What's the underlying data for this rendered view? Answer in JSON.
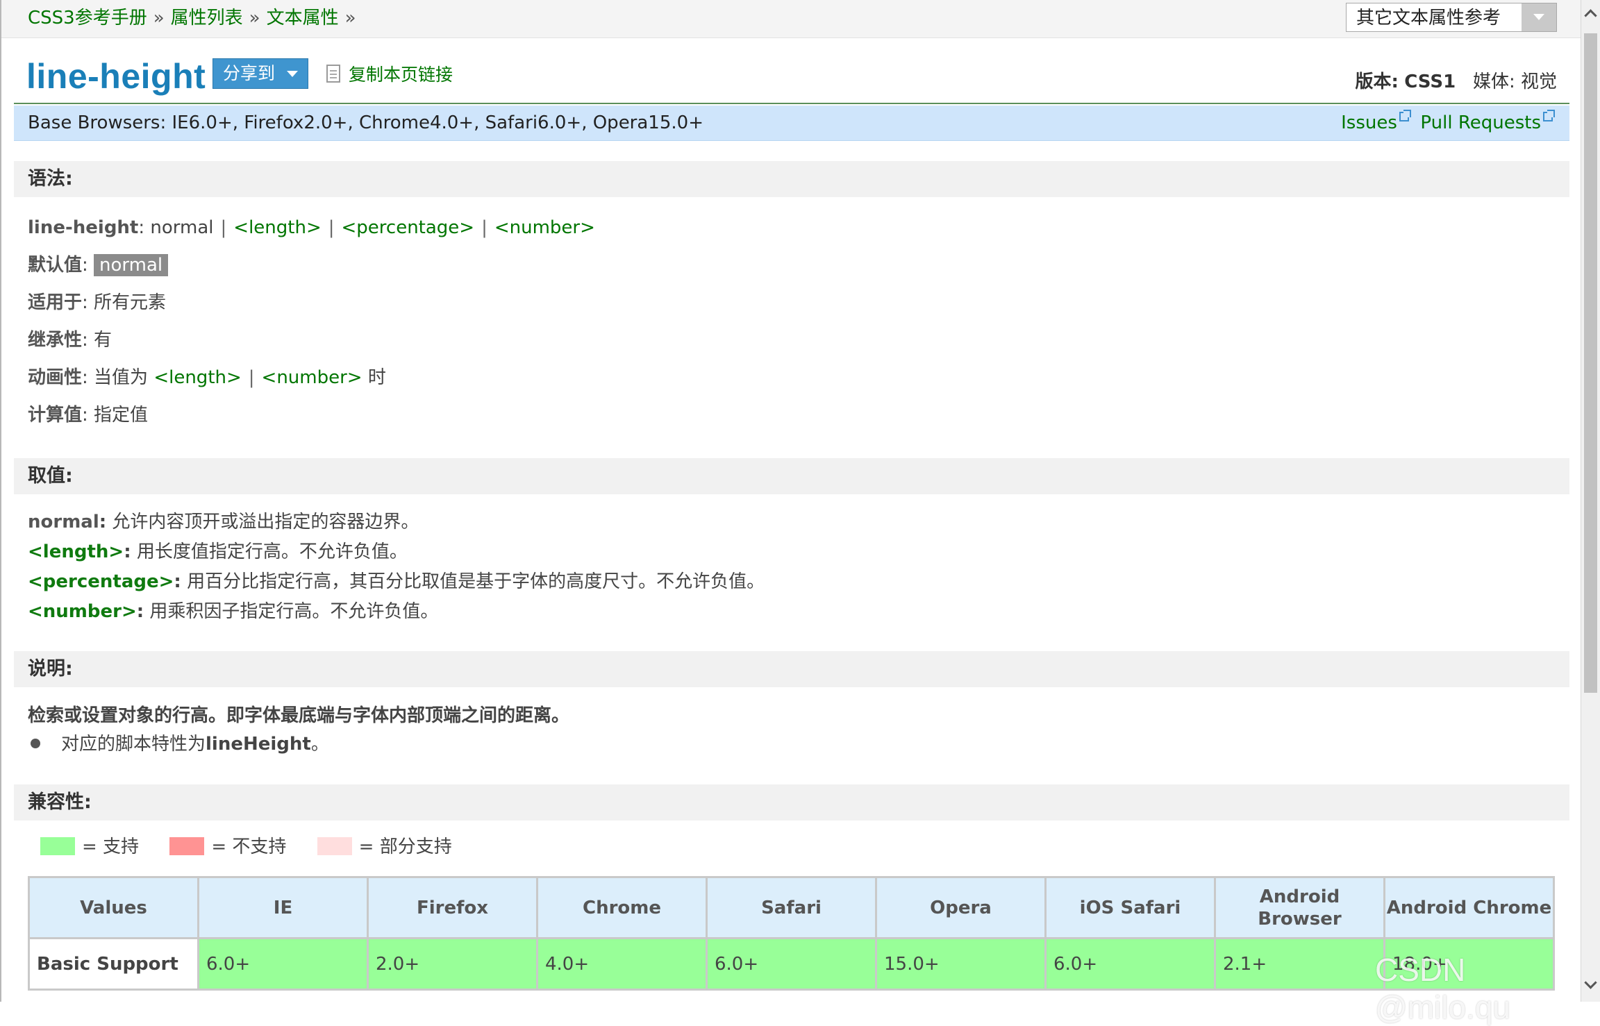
{
  "breadcrumb": {
    "items": [
      "CSS3参考手册",
      "属性列表",
      "文本属性"
    ],
    "separator": "»"
  },
  "related_select": {
    "value": "其它文本属性参考"
  },
  "header": {
    "title": "line-height",
    "share_label": "分享到",
    "copy_link_label": "复制本页链接",
    "version_label": "版本:",
    "version_value": "CSS1",
    "media_label": "媒体:",
    "media_value": "视觉"
  },
  "browsers_bar": {
    "text": "Base Browsers: IE6.0+, Firefox2.0+, Chrome4.0+, Safari6.0+, Opera15.0+",
    "issues_label": "Issues",
    "pull_requests_label": "Pull Requests"
  },
  "syntax": {
    "heading": "语法:",
    "prop_name": "line-height",
    "colon": ":",
    "plain_value": "normal",
    "pipe": "|",
    "value_links": [
      "<length>",
      "<percentage>",
      "<number>"
    ],
    "default_label": "默认值",
    "default_value": "normal",
    "applies_label": "适用于",
    "applies_value": "所有元素",
    "inherit_label": "继承性",
    "inherit_value": "有",
    "anim_label": "动画性",
    "anim_prefix": "当值为",
    "anim_links": [
      "<length>",
      "<number>"
    ],
    "anim_suffix": "时",
    "computed_label": "计算值",
    "computed_value": "指定值"
  },
  "values": {
    "heading": "取值:",
    "items": [
      {
        "key": "normal",
        "text": "允许内容顶开或溢出指定的容器边界。"
      },
      {
        "key": "<length>",
        "text": "用长度值指定行高。不允许负值。"
      },
      {
        "key": "<percentage>",
        "text": "用百分比指定行高，其百分比取值是基于字体的高度尺寸。不允许负值。"
      },
      {
        "key": "<number>",
        "text": "用乘积因子指定行高。不允许负值。"
      }
    ]
  },
  "description": {
    "heading": "说明:",
    "text": "检索或设置对象的行高。即字体最底端与字体内部顶端之间的距离。",
    "bullet_prefix": "对应的脚本特性为",
    "bullet_code": "lineHeight",
    "bullet_suffix": "。"
  },
  "compatibility": {
    "heading": "兼容性:",
    "legend": [
      {
        "label": "= 支持",
        "color": "#98ff98"
      },
      {
        "label": "= 不支持",
        "color": "#ff9393"
      },
      {
        "label": "= 部分支持",
        "color": "#ffdede"
      }
    ],
    "headers": [
      "Values",
      "IE",
      "Firefox",
      "Chrome",
      "Safari",
      "Opera",
      "iOS Safari",
      "Android Browser",
      "Android Chrome"
    ],
    "rows": [
      {
        "label": "Basic Support",
        "cells": [
          "6.0+",
          "2.0+",
          "4.0+",
          "6.0+",
          "15.0+",
          "6.0+",
          "2.1+",
          "18.0+"
        ]
      }
    ]
  },
  "watermark": "CSDN @milo.qu",
  "colors": {
    "link": "#007500",
    "title": "#1a7fb8",
    "supported": "#98ff98",
    "header_bg": "#dceefb",
    "browsers_bar": "#cfe5fb"
  }
}
